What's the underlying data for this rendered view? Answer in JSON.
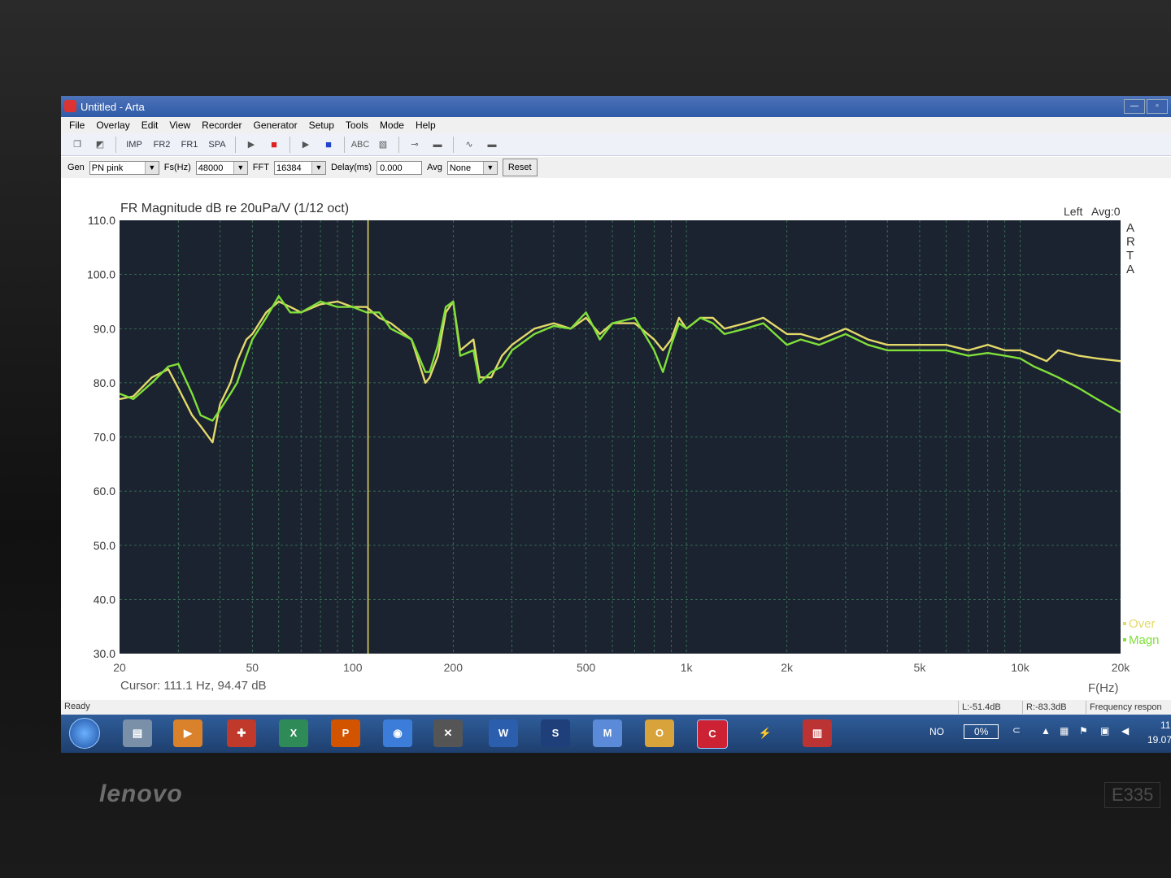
{
  "window": {
    "title": "Untitled - Arta"
  },
  "menu": [
    "File",
    "Overlay",
    "Edit",
    "View",
    "Recorder",
    "Generator",
    "Setup",
    "Tools",
    "Mode",
    "Help"
  ],
  "toolbar": {
    "imp": "IMP",
    "fr2": "FR2",
    "fr1": "FR1",
    "spa": "SPA",
    "abc": "ABC"
  },
  "controls": {
    "gen_label": "Gen",
    "gen_value": "PN pink",
    "fs_label": "Fs(Hz)",
    "fs_value": "48000",
    "fft_label": "FFT",
    "fft_value": "16384",
    "delay_label": "Delay(ms)",
    "delay_value": "0.000",
    "avg_label": "Avg",
    "avg_value": "None",
    "reset_label": "Reset"
  },
  "chart_data": {
    "type": "line",
    "title": "FR Magnitude dB re 20uPa/V (1/12 oct)",
    "channel": "Left",
    "avg": "Avg:0",
    "side_label": "ARTA",
    "xlabel": "F(Hz)",
    "x_scale": "log",
    "xlim": [
      20,
      20000
    ],
    "ylim": [
      30,
      110
    ],
    "x_ticks": [
      20,
      50,
      100,
      200,
      500,
      1000,
      2000,
      5000,
      10000,
      20000
    ],
    "x_tick_labels": [
      "20",
      "50",
      "100",
      "200",
      "500",
      "1k",
      "2k",
      "5k",
      "10k",
      "20k"
    ],
    "y_ticks": [
      30,
      40,
      50,
      60,
      70,
      80,
      90,
      100,
      110
    ],
    "y_tick_labels": [
      "30.0",
      "40.0",
      "50.0",
      "60.0",
      "70.0",
      "80.0",
      "90.0",
      "100.0",
      "110.0"
    ],
    "grid": true,
    "legend_position": "bottom-right",
    "cursor_x": 111.1,
    "cursor_text": "Cursor:  111.1 Hz, 94.47 dB",
    "series": [
      {
        "name": "Over",
        "color": "#e3d96a",
        "x": [
          20,
          22,
          25,
          28,
          30,
          33,
          35,
          38,
          40,
          43,
          45,
          48,
          50,
          55,
          60,
          65,
          70,
          80,
          90,
          100,
          110,
          120,
          130,
          150,
          165,
          170,
          180,
          190,
          200,
          210,
          230,
          240,
          260,
          280,
          300,
          350,
          400,
          450,
          500,
          550,
          600,
          700,
          800,
          850,
          900,
          950,
          1000,
          1050,
          1100,
          1200,
          1300,
          1500,
          1700,
          2000,
          2200,
          2500,
          3000,
          3500,
          4000,
          4500,
          5000,
          6000,
          7000,
          8000,
          9000,
          10000,
          11000,
          12000,
          13000,
          15000,
          17000,
          20000
        ],
        "y": [
          77,
          77.5,
          81,
          82.5,
          79,
          74,
          72,
          69,
          76,
          80,
          84,
          88,
          89,
          93,
          95,
          94,
          93,
          94.5,
          95,
          94,
          94,
          92,
          91,
          88,
          80,
          81,
          85,
          93,
          95,
          86,
          88,
          81,
          81,
          85,
          87,
          90,
          91,
          90,
          92,
          89,
          91,
          91,
          88,
          86,
          88,
          92,
          90,
          91,
          92,
          92,
          90,
          91,
          92,
          89,
          89,
          88,
          90,
          88,
          87,
          87,
          87,
          87,
          86,
          87,
          86,
          86,
          85,
          84,
          86,
          85,
          84.5,
          84
        ]
      },
      {
        "name": "Magn",
        "color": "#7fe03a",
        "x": [
          20,
          22,
          25,
          28,
          30,
          33,
          35,
          38,
          40,
          43,
          45,
          48,
          50,
          55,
          60,
          65,
          70,
          80,
          90,
          100,
          110,
          120,
          130,
          150,
          165,
          170,
          180,
          190,
          200,
          210,
          230,
          240,
          260,
          280,
          300,
          350,
          400,
          450,
          500,
          550,
          600,
          700,
          800,
          850,
          900,
          950,
          1000,
          1050,
          1100,
          1200,
          1300,
          1500,
          1700,
          2000,
          2200,
          2500,
          3000,
          3500,
          4000,
          4500,
          5000,
          6000,
          7000,
          8000,
          9000,
          10000,
          11000,
          12000,
          13000,
          15000,
          17000,
          20000
        ],
        "y": [
          78,
          77,
          80,
          83,
          83.5,
          78,
          74,
          73,
          75,
          78,
          80,
          85,
          88,
          92,
          96,
          93,
          93,
          95,
          94,
          94,
          93,
          93,
          90,
          88,
          82,
          82,
          87,
          94,
          95,
          85,
          86,
          80,
          82,
          83,
          86,
          89,
          90.5,
          90,
          93,
          88,
          91,
          92,
          86,
          82,
          87,
          91,
          90,
          91,
          92,
          91,
          89,
          90,
          91,
          87,
          88,
          87,
          89,
          87,
          86,
          86,
          86,
          86,
          85,
          85.5,
          85,
          84.5,
          83,
          82,
          81,
          79,
          77,
          74.5
        ]
      }
    ]
  },
  "status": {
    "ready": "Ready",
    "left": "L:-51.4dB",
    "right": "R:-83.3dB",
    "mode": "Frequency respon"
  },
  "taskbar": {
    "lang": "NO",
    "battery": "0%",
    "time": "11",
    "date": "19.07"
  },
  "laptop": {
    "brand": "lenovo",
    "model": "E335"
  }
}
